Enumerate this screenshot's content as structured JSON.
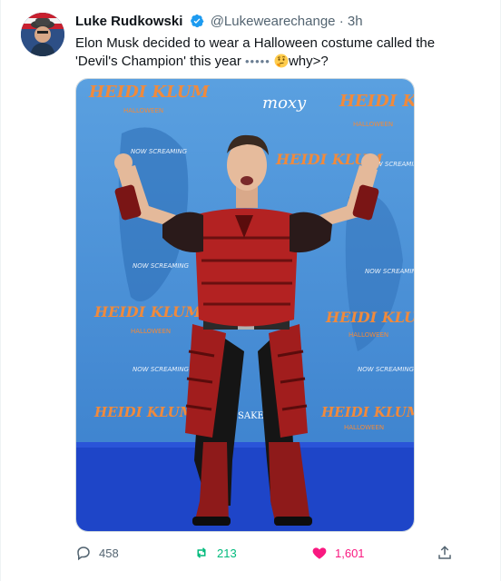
{
  "author": {
    "display_name": "Luke Rudkowski",
    "handle": "@Lukewearechange",
    "separator": "·",
    "timestamp": "3h",
    "verified": true
  },
  "tweet": {
    "text_main": "Elon Musk decided to wear a Halloween costume called the 'Devil's Champion' this year",
    "dots": "•••••",
    "text_tail": "why>?"
  },
  "media": {
    "backdrop_brand": "HEIDI KLUM",
    "backdrop_sub": "HALLOWEEN",
    "backdrop_sponsor": "NOW SCREAMING",
    "backdrop_venue": "moxy",
    "backdrop_sake": "SAKE"
  },
  "actions": {
    "replies": "458",
    "retweets": "213",
    "likes": "1,601"
  },
  "colors": {
    "verified": "#1d9bf0",
    "retweet": "#00ba7c",
    "like": "#f91880",
    "muted": "#536471",
    "backdrop": "#4a8fd4",
    "carpet": "#1e45c8"
  }
}
